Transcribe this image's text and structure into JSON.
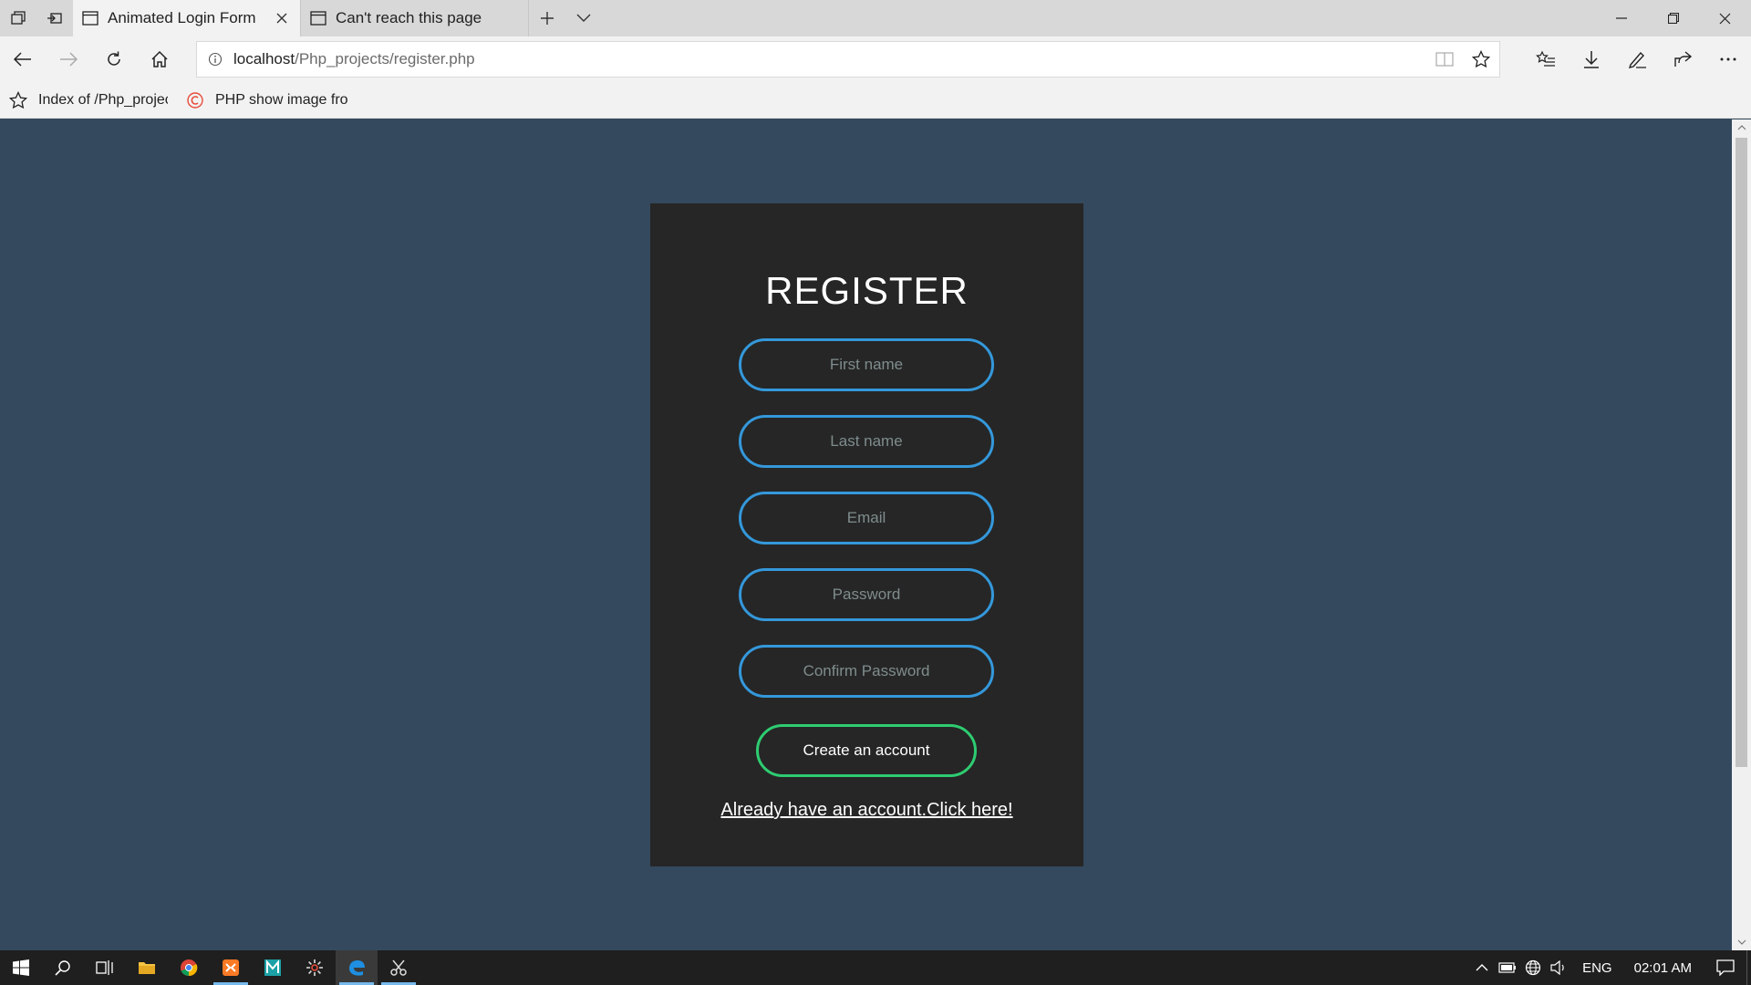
{
  "browser": {
    "tabs": [
      {
        "title": "Animated Login Form",
        "active": true
      },
      {
        "title": "Can't reach this page",
        "active": false
      }
    ],
    "address": {
      "host": "localhost",
      "path": "/Php_projects/register.php"
    },
    "favorites": [
      {
        "label": "Index of /Php_projec",
        "icon": "star-icon"
      },
      {
        "label": "PHP show image fro",
        "icon": "site-logo-icon"
      }
    ]
  },
  "form": {
    "title": "REGISTER",
    "fields": {
      "first_name": "First name",
      "last_name": "Last name",
      "email": "Email",
      "password": "Password",
      "confirm_password": "Confirm Password"
    },
    "submit_label": "Create an account",
    "login_link": "Already have an account.Click here!"
  },
  "taskbar": {
    "language": "ENG",
    "time": "02:01 AM"
  },
  "colors": {
    "page_bg": "#34495e",
    "card_bg": "#262626",
    "input_border": "#3498db",
    "button_border": "#2ecc71"
  }
}
